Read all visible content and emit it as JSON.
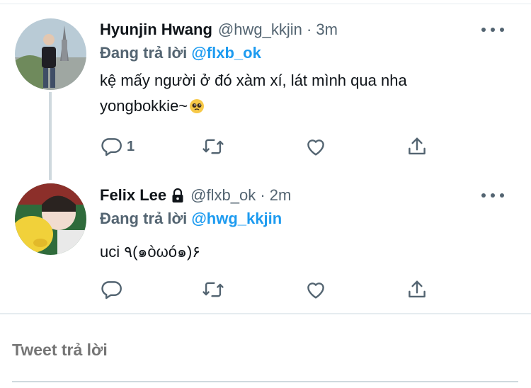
{
  "tweets": [
    {
      "name": "Hyunjin Hwang",
      "handle": "@hwg_kkjin",
      "time": "3m",
      "replying_prefix": "Đang trả lời",
      "replying_to": "@flxb_ok",
      "text": "kệ mấy người ở đó xàm xí, lát mình qua nha yongbokkie~",
      "reply_count": "1",
      "protected": false
    },
    {
      "name": "Felix Lee",
      "handle": "@flxb_ok",
      "time": "2m",
      "replying_prefix": "Đang trả lời",
      "replying_to": "@hwg_kkjin",
      "text": "uci ٩(๑òωó๑)۶",
      "reply_count": "",
      "protected": true
    }
  ],
  "compose": {
    "placeholder": "Tweet trả lời"
  },
  "colors": {
    "accent": "#1d9bf0",
    "secondary_text": "#536471",
    "divider": "#e6ecf0"
  },
  "icons": [
    "more-icon",
    "reply-icon",
    "retweet-icon",
    "like-icon",
    "share-icon",
    "lock-icon",
    "pleading-face-emoji"
  ]
}
